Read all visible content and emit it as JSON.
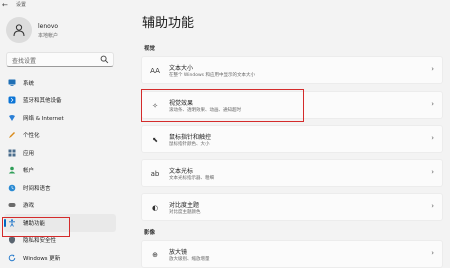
{
  "titlebar": {
    "back_icon": "back-arrow-icon",
    "title": "设置"
  },
  "user": {
    "name": "lenovo",
    "account_type": "本地帐户"
  },
  "search": {
    "placeholder": "查找设置"
  },
  "sidebar": {
    "items": [
      {
        "label": "系统",
        "icon": "system-icon",
        "color": "#1f6fb5"
      },
      {
        "label": "蓝牙和其他设备",
        "icon": "bluetooth-icon",
        "color": "#0a74d6"
      },
      {
        "label": "网络 & Internet",
        "icon": "network-icon",
        "color": "#2b7fd6"
      },
      {
        "label": "个性化",
        "icon": "personalization-icon",
        "color": "#d98a1a"
      },
      {
        "label": "应用",
        "icon": "apps-icon",
        "color": "#4a6c8c"
      },
      {
        "label": "帐户",
        "icon": "accounts-icon",
        "color": "#2f9e58"
      },
      {
        "label": "时间和语言",
        "icon": "time-language-icon",
        "color": "#2a8ad3"
      },
      {
        "label": "游戏",
        "icon": "gaming-icon",
        "color": "#6a6a6a"
      },
      {
        "label": "辅助功能",
        "icon": "accessibility-icon",
        "color": "#1a73c9",
        "active": true
      },
      {
        "label": "隐私和安全性",
        "icon": "privacy-icon",
        "color": "#5a6570"
      },
      {
        "label": "Windows 更新",
        "icon": "windows-update-icon",
        "color": "#1a73c9"
      }
    ]
  },
  "main": {
    "title": "辅助功能",
    "sections": {
      "vision": "视觉",
      "hearing": "影像"
    },
    "cards": [
      {
        "title": "文本大小",
        "desc": "在整个 Windows 和应用中显示的文本大小",
        "icon": "text-size-icon"
      },
      {
        "title": "视觉效果",
        "desc": "滚动条、透明效果、动画、通知超时",
        "icon": "visual-effects-icon"
      },
      {
        "title": "鼠标指针和触控",
        "desc": "鼠标指针颜色、大小",
        "icon": "mouse-pointer-icon"
      },
      {
        "title": "文本光标",
        "desc": "文本光标指示器、粗细",
        "icon": "text-cursor-icon"
      },
      {
        "title": "对比度主题",
        "desc": "对比度主题颜色",
        "icon": "contrast-theme-icon"
      },
      {
        "title": "放大镜",
        "desc": "放大级别、缩放增量",
        "icon": "magnifier-icon"
      }
    ]
  },
  "accent_color": "#0067c0",
  "highlight_color": "#d42b2b"
}
